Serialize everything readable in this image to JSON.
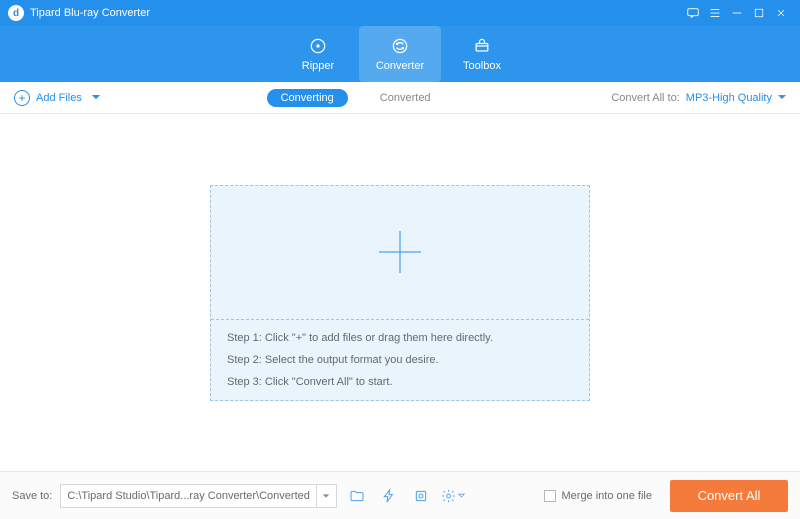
{
  "titlebar": {
    "app_name": "Tipard Blu-ray Converter"
  },
  "nav": {
    "ripper": "Ripper",
    "converter": "Converter",
    "toolbox": "Toolbox"
  },
  "subbar": {
    "add_files": "Add Files",
    "tab_converting": "Converting",
    "tab_converted": "Converted",
    "convert_all_to_label": "Convert All to:",
    "convert_all_to_value": "MP3-High Quality"
  },
  "dropzone": {
    "step1": "Step 1: Click \"+\" to add files or drag them here directly.",
    "step2": "Step 2: Select the output format you desire.",
    "step3": "Step 3: Click \"Convert All\" to start."
  },
  "bottombar": {
    "save_to_label": "Save to:",
    "path": "C:\\Tipard Studio\\Tipard...ray Converter\\Converted",
    "merge_label": "Merge into one file",
    "convert_all": "Convert All"
  }
}
